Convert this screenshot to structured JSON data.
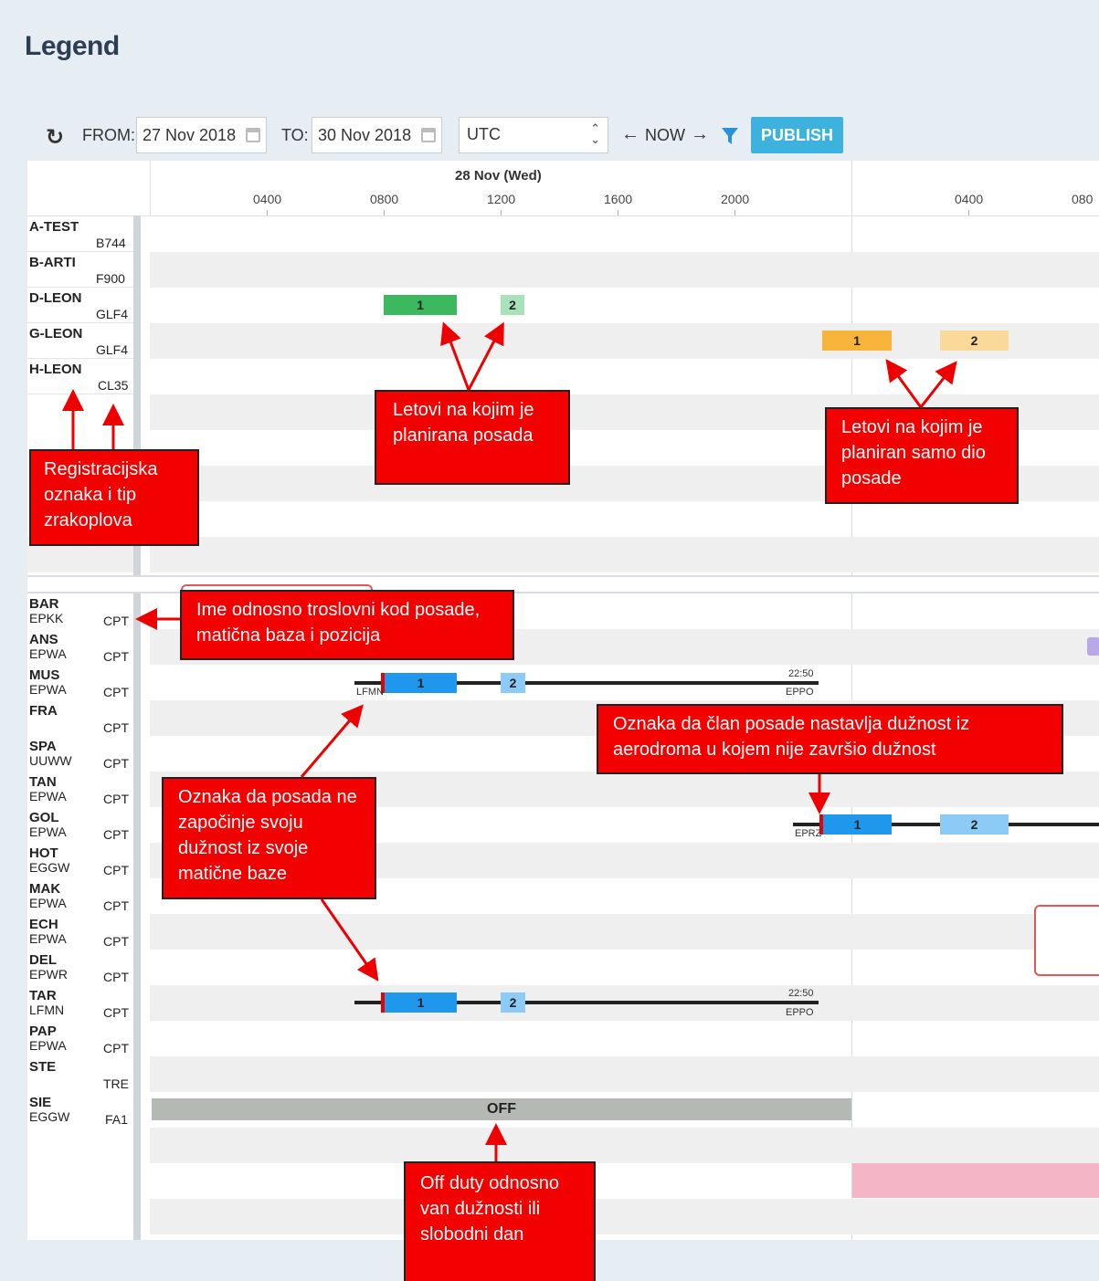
{
  "page": {
    "title": "Legend"
  },
  "toolbar": {
    "from_label": "FROM:",
    "from_value": "27 Nov 2018",
    "to_label": "TO:",
    "to_value": "30 Nov 2018",
    "timezone": "UTC",
    "prev_label": "←",
    "now_label": "NOW",
    "next_label": "→",
    "publish_label": "PUBLISH",
    "accent_color": "#3db2df"
  },
  "timeline": {
    "date": "28 Nov (Wed)",
    "ticks": [
      "0400",
      "0800",
      "1200",
      "1600",
      "2000",
      "0400",
      "080"
    ]
  },
  "aircraft": [
    {
      "reg": "A-TEST",
      "type": "B744"
    },
    {
      "reg": "B-ARTI",
      "type": "F900"
    },
    {
      "reg": "D-LEON",
      "type": "GLF4"
    },
    {
      "reg": "G-LEON",
      "type": "GLF4"
    },
    {
      "reg": "H-LEON",
      "type": "CL35"
    }
  ],
  "crew": [
    {
      "code": "BAR",
      "base": "EPKK",
      "pos": "CPT"
    },
    {
      "code": "ANS",
      "base": "EPWA",
      "pos": "CPT"
    },
    {
      "code": "MUS",
      "base": "EPWA",
      "pos": "CPT"
    },
    {
      "code": "FRA",
      "base": "",
      "pos": "CPT"
    },
    {
      "code": "SPA",
      "base": "UUWW",
      "pos": "CPT"
    },
    {
      "code": "TAN",
      "base": "EPWA",
      "pos": "CPT"
    },
    {
      "code": "GOL",
      "base": "EPWA",
      "pos": "CPT"
    },
    {
      "code": "HOT",
      "base": "EGGW",
      "pos": "CPT"
    },
    {
      "code": "MAK",
      "base": "EPWA",
      "pos": "CPT"
    },
    {
      "code": "ECH",
      "base": "EPWA",
      "pos": "CPT"
    },
    {
      "code": "DEL",
      "base": "EPWR",
      "pos": "CPT"
    },
    {
      "code": "TAR",
      "base": "LFMN",
      "pos": "CPT"
    },
    {
      "code": "PAP",
      "base": "EPWA",
      "pos": "CPT"
    },
    {
      "code": "STE",
      "base": "",
      "pos": "TRE"
    },
    {
      "code": "SIE",
      "base": "EGGW",
      "pos": "FA1"
    }
  ],
  "flights": {
    "one": "1",
    "two": "2"
  },
  "duty": {
    "mus_start": "LFMN",
    "mus_end_time": "22:50",
    "mus_end_ap": "EPPO",
    "tar_end_time": "22:50",
    "tar_end_ap": "EPPO",
    "gol_start": "EPRZ",
    "off_label": "OFF"
  },
  "callouts": {
    "registration": "Registracijska oznaka i tip zrakoplova",
    "planned_crew": "Letovi na kojim je planirana posada",
    "partial_crew": "Letovi na kojim je planiran samo dio posade",
    "crew_name": "Ime odnosno troslovni kod posade, matična baza i pozicija",
    "continue_duty": "Oznaka da član posade nastavlja dužnost iz aerodroma u kojem nije završio dužnost",
    "not_home_base": "Oznaka da posada ne započinje svoju dužnost iz svoje matične baze",
    "off_duty": "Off duty odnosno van dužnosti ili slobodni dan"
  }
}
